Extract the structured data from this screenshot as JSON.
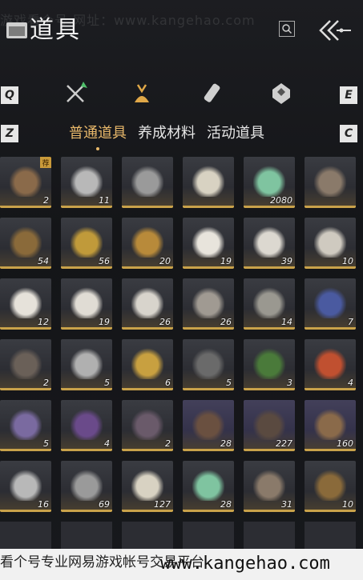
{
  "watermark": "游戏看个号  网址：www.kangehao.com",
  "header": {
    "title": "道具"
  },
  "side_keys": {
    "q": "Q",
    "e": "E",
    "z": "Z",
    "c": "C"
  },
  "category_tabs": [
    "weapon-icon",
    "bag-icon",
    "scroll-icon",
    "gem-icon"
  ],
  "subtabs": [
    "普通道具",
    "养成材料",
    "活动道具"
  ],
  "badge": "荐",
  "items": [
    [
      "2",
      "11",
      "",
      "",
      "2080",
      ""
    ],
    [
      "54",
      "56",
      "20",
      "19",
      "39",
      "10"
    ],
    [
      "12",
      "19",
      "26",
      "26",
      "14",
      "7"
    ],
    [
      "2",
      "5",
      "6",
      "5",
      "3",
      "4"
    ],
    [
      "5",
      "4",
      "2",
      "28",
      "227",
      "160"
    ],
    [
      "16",
      "69",
      "127",
      "28",
      "31",
      "10"
    ]
  ],
  "bottom": {
    "text": "看个号专业网易游戏帐号交易平台",
    "url": "www.kangehao.com"
  }
}
